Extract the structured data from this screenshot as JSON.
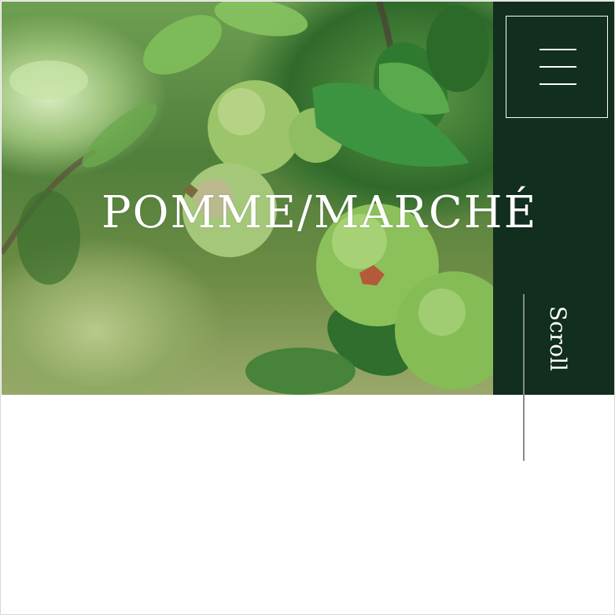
{
  "header": {
    "title": "POMME/MARCHÉ",
    "menu_icon": "hamburger-menu-icon"
  },
  "hero": {
    "image_subject": "green apples on branch"
  },
  "scroll": {
    "label": "Scroll"
  },
  "colors": {
    "brand_dark_green": "#112e1f",
    "text_white": "#ffffff",
    "scroll_line": "#8a8a8a",
    "page_background": "#ffffff"
  }
}
